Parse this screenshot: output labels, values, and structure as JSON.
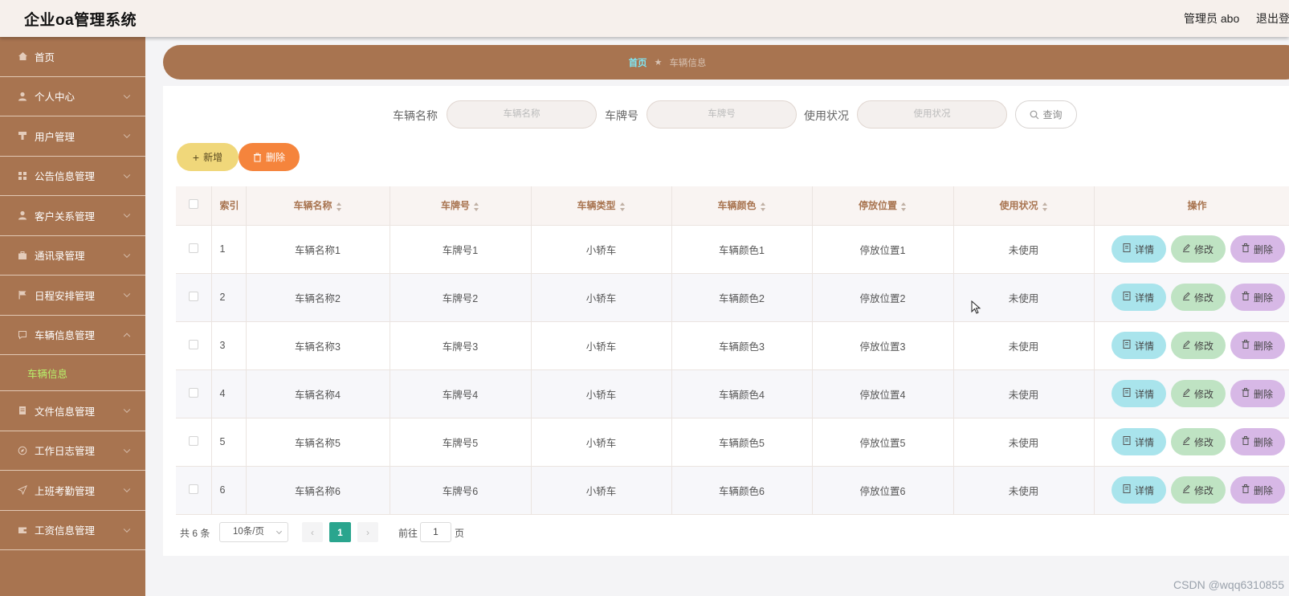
{
  "header": {
    "title": "企业oa管理系统",
    "user": "管理员 abo",
    "logout": "退出登"
  },
  "sidebar": {
    "items": [
      {
        "label": "首页",
        "icon": "home-icon",
        "expand": "none"
      },
      {
        "label": "个人中心",
        "icon": "user-icon",
        "expand": "down"
      },
      {
        "label": "用户管理",
        "icon": "pin-icon",
        "expand": "down"
      },
      {
        "label": "公告信息管理",
        "icon": "grid-icon",
        "expand": "down"
      },
      {
        "label": "客户关系管理",
        "icon": "user-icon",
        "expand": "down"
      },
      {
        "label": "通讯录管理",
        "icon": "briefcase-icon",
        "expand": "down"
      },
      {
        "label": "日程安排管理",
        "icon": "flag-icon",
        "expand": "down"
      },
      {
        "label": "车辆信息管理",
        "icon": "chat-icon",
        "expand": "up"
      },
      {
        "label": "文件信息管理",
        "icon": "document-icon",
        "expand": "down"
      },
      {
        "label": "工作日志管理",
        "icon": "compass-icon",
        "expand": "down"
      },
      {
        "label": "上班考勤管理",
        "icon": "send-icon",
        "expand": "down"
      },
      {
        "label": "工资信息管理",
        "icon": "wallet-icon",
        "expand": "down"
      }
    ],
    "active_sub": "车辆信息"
  },
  "breadcrumb": {
    "home": "首页",
    "current": "车辆信息"
  },
  "search": {
    "name_label": "车辆名称",
    "name_placeholder": "车辆名称",
    "plate_label": "车牌号",
    "plate_placeholder": "车牌号",
    "status_label": "使用状况",
    "status_placeholder": "使用状况",
    "button": "查询"
  },
  "actions": {
    "add": "新增",
    "delete": "删除"
  },
  "table": {
    "headers": [
      "索引",
      "车辆名称",
      "车牌号",
      "车辆类型",
      "车辆颜色",
      "停放位置",
      "使用状况",
      "操作"
    ],
    "rows": [
      {
        "idx": "1",
        "name": "车辆名称1",
        "plate": "车牌号1",
        "type": "小轿车",
        "color": "车辆颜色1",
        "location": "停放位置1",
        "status": "未使用"
      },
      {
        "idx": "2",
        "name": "车辆名称2",
        "plate": "车牌号2",
        "type": "小轿车",
        "color": "车辆颜色2",
        "location": "停放位置2",
        "status": "未使用"
      },
      {
        "idx": "3",
        "name": "车辆名称3",
        "plate": "车牌号3",
        "type": "小轿车",
        "color": "车辆颜色3",
        "location": "停放位置3",
        "status": "未使用"
      },
      {
        "idx": "4",
        "name": "车辆名称4",
        "plate": "车牌号4",
        "type": "小轿车",
        "color": "车辆颜色4",
        "location": "停放位置4",
        "status": "未使用"
      },
      {
        "idx": "5",
        "name": "车辆名称5",
        "plate": "车牌号5",
        "type": "小轿车",
        "color": "车辆颜色5",
        "location": "停放位置5",
        "status": "未使用"
      },
      {
        "idx": "6",
        "name": "车辆名称6",
        "plate": "车牌号6",
        "type": "小轿车",
        "color": "车辆颜色6",
        "location": "停放位置6",
        "status": "未使用"
      }
    ],
    "row_actions": {
      "detail": "详情",
      "edit": "修改",
      "delete": "删除"
    }
  },
  "pagination": {
    "total": "共 6 条",
    "page_size": "10条/页",
    "current": "1",
    "goto_label": "前往",
    "goto_value": "1",
    "goto_unit": "页"
  },
  "watermark": "CSDN @wqq6310855",
  "colors": {
    "sidebar": "#a87450",
    "accent_green": "#2aa58e",
    "header_bg": "#f6f0ec"
  }
}
